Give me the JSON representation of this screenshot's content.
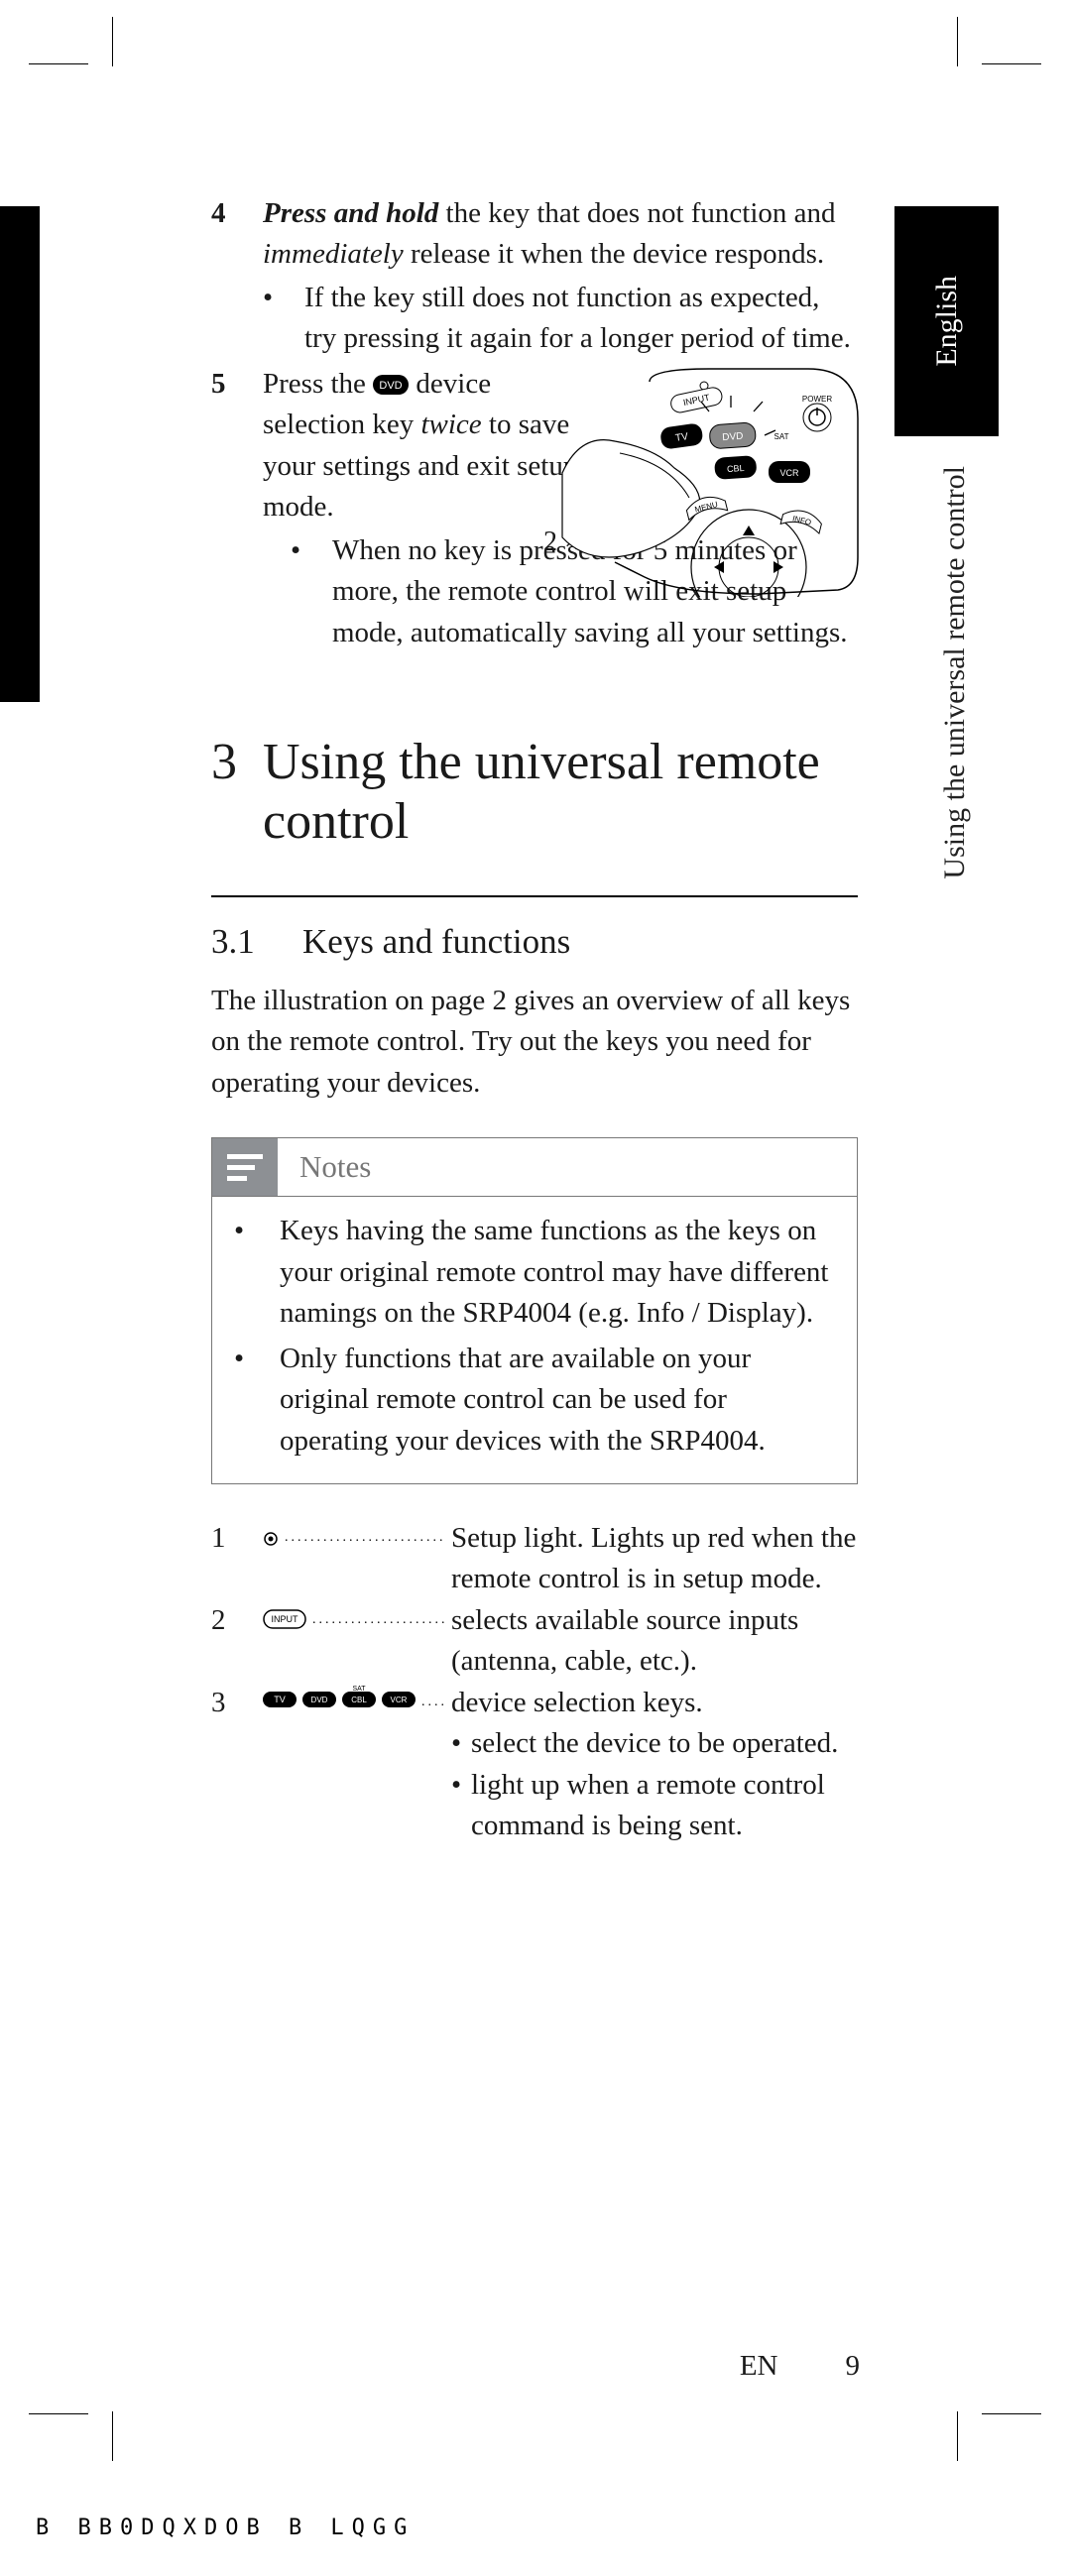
{
  "side": {
    "language_tab": "English",
    "section_header": "Using the universal remote control"
  },
  "steps": {
    "s4": {
      "num": "4",
      "text_pre": "Press and hold",
      "text_mid1": " the key that does not function and ",
      "text_em": "immediately",
      "text_mid2": " release it when the device responds.",
      "bullet": "If the key still does not function as expected, try pressing it again for a longer period of time."
    },
    "s5": {
      "num": "5",
      "line1_pre": "Press the ",
      "dvd_label": "DVD",
      "line1_post": " device selection key ",
      "line1_em": "twice",
      "line1_end": " to save your settings and exit setup mode.",
      "two_x": "2 ×",
      "sub": "When no key is pressed for 5 minutes or more, the remote control will exit setup mode, automatically saving all your settings."
    }
  },
  "illustration": {
    "buttons": {
      "input": "INPUT",
      "power": "POWER",
      "tv": "TV",
      "dvd": "DVD",
      "sat": "SAT",
      "cbl": "CBL",
      "vcr": "VCR",
      "menu": "MENU",
      "info": "INFO"
    }
  },
  "h1": {
    "num": "3",
    "title": "Using the universal remote control"
  },
  "h2": {
    "num": "3.1",
    "title": "Keys and functions"
  },
  "intro_para": "The illustration on page 2 gives an overview of all keys on the remote control. Try out the keys you need for operating your devices.",
  "notes": {
    "label": "Notes",
    "b1": "Keys having the same functions as the keys on your original remote control may have different namings on the SRP4004 (e.g. Info / Display).",
    "b2": "Only functions that are available on your original remote control can be used for operating your devices with the SRP4004."
  },
  "keys": {
    "k1": {
      "num": "1",
      "desc": "Setup light. Lights up red when the remote control is in setup mode."
    },
    "k2": {
      "num": "2",
      "icon_label": "INPUT",
      "desc": "selects available source inputs (antenna, cable, etc.)."
    },
    "k3": {
      "num": "3",
      "icons": {
        "tv": "TV",
        "dvd": "DVD",
        "sat_top": "SAT",
        "cbl": "CBL",
        "vcr": "VCR"
      },
      "desc": "device selection keys.",
      "sub1": "select the device to be operated.",
      "sub2": "light up when a remote control command is being sent."
    }
  },
  "footer": {
    "lang": "EN",
    "page": "9",
    "code": "B  BB0DQXDOB  B   LQGG"
  }
}
